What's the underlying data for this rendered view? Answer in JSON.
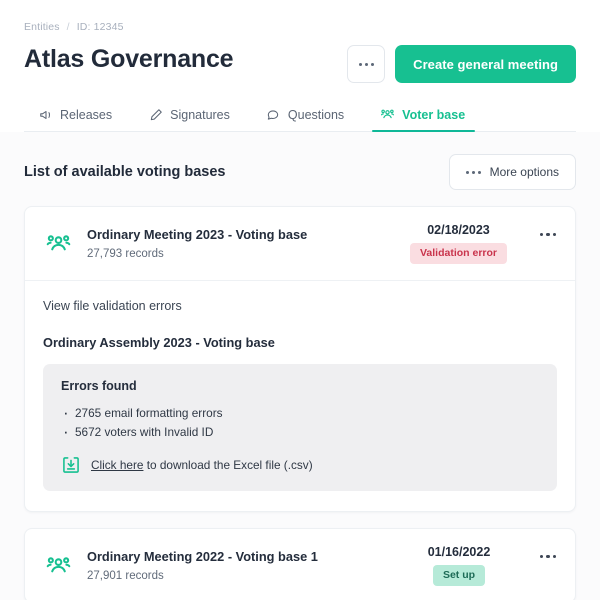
{
  "breadcrumb": {
    "root": "Entities",
    "separator": "/",
    "id": "ID: 12345"
  },
  "header": {
    "title": "Atlas Governance",
    "ellipsis_button_label": "···",
    "primary_button_label": "Create general meeting",
    "accent_color": "#17c091"
  },
  "tabs": [
    {
      "label": "Releases",
      "icon": "megaphone-icon",
      "active": false
    },
    {
      "label": "Signatures",
      "icon": "pen-icon",
      "active": false
    },
    {
      "label": "Questions",
      "icon": "chat-icon",
      "active": false
    },
    {
      "label": "Voter base",
      "icon": "voters-icon",
      "active": true
    }
  ],
  "section": {
    "title": "List of available voting bases",
    "more_options_label": "More options"
  },
  "voting_bases": [
    {
      "name": "Ordinary Meeting 2023 - Voting base",
      "records": "27,793 records",
      "date": "02/18/2023",
      "status": "Validation error",
      "status_type": "error",
      "status_bg": "#fadde1",
      "status_fg": "#c9344c",
      "expanded": true,
      "details": {
        "link_title": "View file validation errors",
        "subtitle": "Ordinary Assembly 2023 - Voting base",
        "errors_title": "Errors found",
        "errors": [
          "2765 email formatting errors",
          "5672 voters with Invalid ID"
        ],
        "download_link_text": "Click here",
        "download_suffix_text": " to download the Excel file (.csv)"
      }
    },
    {
      "name": "Ordinary Meeting 2022 - Voting base 1",
      "records": "27,901 records",
      "date": "01/16/2022",
      "status": "Set up",
      "status_type": "setup",
      "status_bg": "#b6ead8",
      "status_fg": "#1d6b56",
      "expanded": false
    }
  ]
}
